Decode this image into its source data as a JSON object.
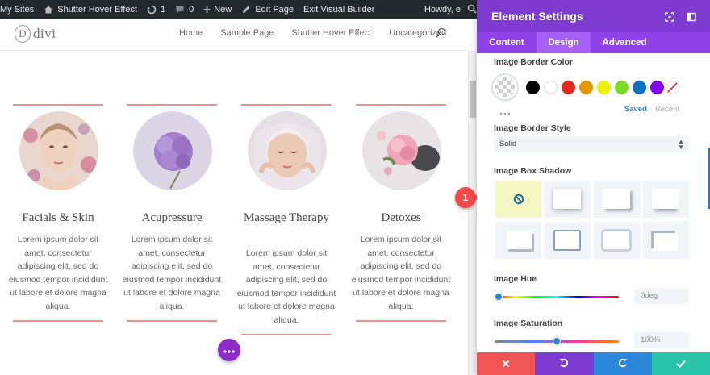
{
  "adminbar": {
    "my_sites": "My Sites",
    "site_name": "Shutter Hover Effect",
    "updates": "1",
    "comments": "0",
    "new": "New",
    "edit_page": "Edit Page",
    "exit_builder": "Exit Visual Builder",
    "howdy": "Howdy, e"
  },
  "site": {
    "logo_letter": "D",
    "logo_text": "divi",
    "nav": [
      "Home",
      "Sample Page",
      "Shutter Hover Effect",
      "Uncategorized"
    ]
  },
  "columns": [
    {
      "title": "Facials & Skin",
      "body": "Lorem ipsum dolor sit amet, consectetur adipiscing elit, sed do eiusmod tempor incididunt ut labore et dolore magna aliqua."
    },
    {
      "title": "Acupressure",
      "body": "Lorem ipsum dolor sit amet, consectetur adipiscing elit, sed do eiusmod tempor incididunt ut labore et dolore magna aliqua."
    },
    {
      "title": "Massage Therapy",
      "body": "Lorem ipsum dolor sit amet, consectetur adipiscing elit, sed do eiusmod tempor incididunt ut labore et dolore magna aliqua."
    },
    {
      "title": "Detoxes",
      "body": "Lorem ipsum dolor sit amet, consectetur adipiscing elit, sed do eiusmod tempor incididunt ut labore et dolore magna aliqua."
    }
  ],
  "panel": {
    "title": "Element Settings",
    "tabs": [
      "Content",
      "Design",
      "Advanced"
    ],
    "active_tab": "Design",
    "border_color_label": "Image Border Color",
    "swatch_colors": [
      "#000000",
      "#ffffff",
      "#e02b20",
      "#e09900",
      "#edf000",
      "#7cda24",
      "#0c71c3",
      "#8300e9"
    ],
    "saved": "Saved",
    "recent": "Recent",
    "border_style_label": "Image Border Style",
    "border_style_value": "Solid",
    "box_shadow_label": "Image Box Shadow",
    "hue_label": "Image Hue",
    "hue_value": "0deg",
    "hue_level": 0,
    "saturation_label": "Image Saturation",
    "saturation_value": "100%",
    "saturation_level": 0.5,
    "callout_number": "1"
  },
  "footer_colors": {
    "cancel": "#ef5555",
    "undo": "#7e3bd0",
    "redo": "#2b87da",
    "save": "#29c4a9"
  }
}
